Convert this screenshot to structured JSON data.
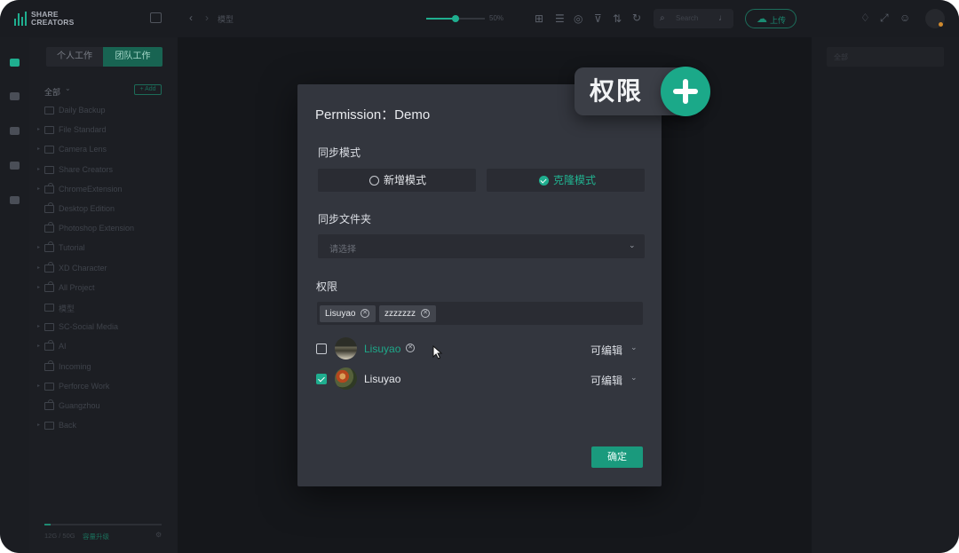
{
  "app": {
    "logo_line1": "SHARE",
    "logo_line2": "CREATORS",
    "accent": "#1fae8f"
  },
  "topbar": {
    "breadcrumb": "模型",
    "zoom_value": "50%",
    "zoom_level": 0.5,
    "search_placeholder": "Search",
    "upload_label": "上传"
  },
  "sidebar": {
    "tab_personal": "个人工作",
    "tab_team": "团队工作",
    "all_label": "全部",
    "add_label": "+ Add",
    "folders": [
      {
        "label": "Daily Backup",
        "caret": "",
        "locked": false
      },
      {
        "label": "File Standard",
        "caret": "▸",
        "locked": false
      },
      {
        "label": "Camera Lens",
        "caret": "▸",
        "locked": false
      },
      {
        "label": "Share Creators",
        "caret": "▸",
        "locked": false
      },
      {
        "label": "ChromeExtension",
        "caret": "▸",
        "locked": true
      },
      {
        "label": "Desktop Edition",
        "caret": "",
        "locked": true
      },
      {
        "label": "Photoshop Extension",
        "caret": "",
        "locked": true
      },
      {
        "label": "Tutorial",
        "caret": "▸",
        "locked": true
      },
      {
        "label": "XD Character",
        "caret": "▸",
        "locked": true
      },
      {
        "label": "All Project",
        "caret": "▸",
        "locked": true
      },
      {
        "label": "模型",
        "caret": "",
        "locked": false
      },
      {
        "label": "SC-Social Media",
        "caret": "▸",
        "locked": false
      },
      {
        "label": "AI",
        "caret": "▸",
        "locked": true
      },
      {
        "label": "Incoming",
        "caret": "",
        "locked": true
      },
      {
        "label": "Perforce Work",
        "caret": "▸",
        "locked": false
      },
      {
        "label": "Guangzhou",
        "caret": "",
        "locked": true
      },
      {
        "label": "Back",
        "caret": "▸",
        "locked": false
      }
    ],
    "storage_text": "12G / 50G",
    "storage_used_fraction": 0.05,
    "upgrade_label": "容量升级"
  },
  "right_panel": {
    "search_placeholder": "全部"
  },
  "modal": {
    "title": "Permission：Demo",
    "sync_mode_label": "同步模式",
    "mode_add": "新增模式",
    "mode_clone": "克隆模式",
    "selected_mode": "克隆模式",
    "sync_folder_label": "同步文件夹",
    "sync_folder_placeholder": "请选择",
    "permission_label": "权限",
    "tags": [
      "Lisuyao",
      "zzzzzzz"
    ],
    "users": [
      {
        "name": "Lisuyao",
        "checked": false,
        "permission": "可编辑"
      },
      {
        "name": "Lisuyao",
        "checked": true,
        "permission": "可编辑"
      }
    ],
    "confirm_label": "确定"
  },
  "badge": {
    "text": "权限"
  }
}
